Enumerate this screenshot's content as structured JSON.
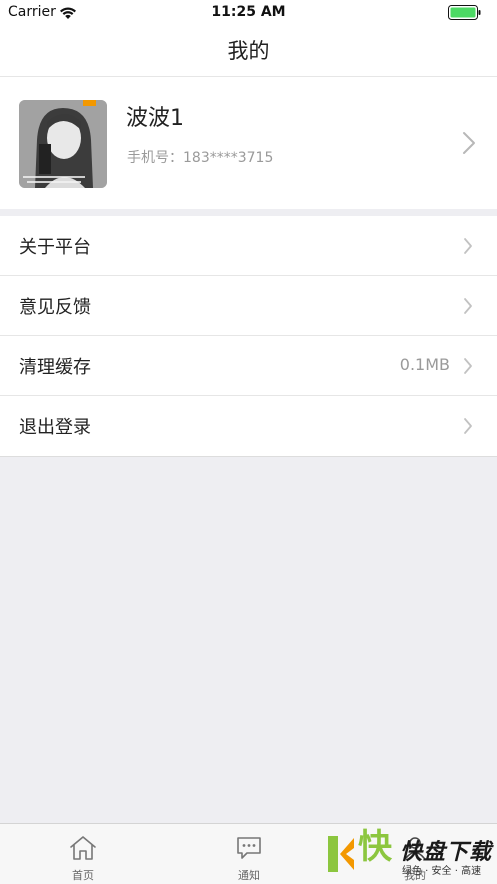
{
  "status_bar": {
    "carrier": "Carrier",
    "time": "11:25 AM"
  },
  "nav": {
    "title": "我的"
  },
  "profile": {
    "name": "波波1",
    "phone": "手机号：183****3715"
  },
  "menu": {
    "items": [
      {
        "label": "关于平台",
        "value": ""
      },
      {
        "label": "意见反馈",
        "value": ""
      },
      {
        "label": "清理缓存",
        "value": "0.1MB"
      },
      {
        "label": "退出登录",
        "value": ""
      }
    ]
  },
  "tab_bar": {
    "tabs": [
      {
        "label": "首页",
        "icon": "home-icon"
      },
      {
        "label": "通知",
        "icon": "message-icon"
      },
      {
        "label": "我的",
        "icon": "profile-icon"
      }
    ]
  },
  "watermark": {
    "name": "快盘下载",
    "tagline": "绿色 · 安全 · 高速"
  },
  "colors": {
    "background": "#eeeef2",
    "battery": "#4cd964",
    "watermark_green": "#8cc63f",
    "watermark_orange": "#f39800"
  }
}
